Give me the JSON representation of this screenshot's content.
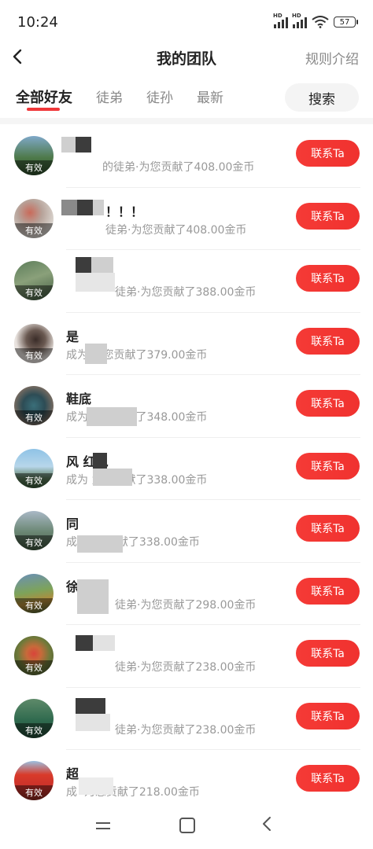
{
  "status": {
    "time": "10:24",
    "battery": "57",
    "hd": "HD"
  },
  "nav": {
    "title": "我的团队",
    "rules": "规则介绍"
  },
  "tabs": [
    {
      "label": "全部好友",
      "active": true
    },
    {
      "label": "徒弟"
    },
    {
      "label": "徒孙"
    },
    {
      "label": "最新"
    }
  ],
  "search_label": "搜索",
  "colors": {
    "accent": "#f0383a"
  },
  "rows": [
    {
      "name": "",
      "desc": "的徒弟·为您贡献了408.00金币",
      "badge": "有效",
      "button": "联系Ta"
    },
    {
      "name": "！！！",
      "desc": "徒弟·为您贡献了408.00金币",
      "badge": "有效",
      "button": "联系Ta"
    },
    {
      "name": "",
      "desc": "徒弟·为您贡献了388.00金币",
      "badge": "有效",
      "button": "联系Ta"
    },
    {
      "name": "是",
      "desc": "成为 为您贡献了379.00金币",
      "badge": "有效",
      "button": "联系Ta"
    },
    {
      "name": "鞋底",
      "desc": "成为 为您贡献了348.00金币",
      "badge": "有效",
      "button": "联系Ta"
    },
    {
      "name": "风 红包",
      "desc": "成为 为您贡献了338.00金币",
      "badge": "有效",
      "button": "联系Ta"
    },
    {
      "name": "同",
      "desc": "成 ·为您贡献了338.00金币",
      "badge": "有效",
      "button": "联系Ta"
    },
    {
      "name": "徐",
      "desc": "徒弟·为您贡献了298.00金币",
      "badge": "有效",
      "button": "联系Ta"
    },
    {
      "name": "",
      "desc": "徒弟·为您贡献了238.00金币",
      "badge": "有效",
      "button": "联系Ta"
    },
    {
      "name": "",
      "desc": "徒弟·为您贡献了238.00金币",
      "badge": "有效",
      "button": "联系Ta"
    },
    {
      "name": "超",
      "desc": "成 ·为您贡献了218.00金币",
      "badge": "有效",
      "button": "联系Ta"
    }
  ]
}
